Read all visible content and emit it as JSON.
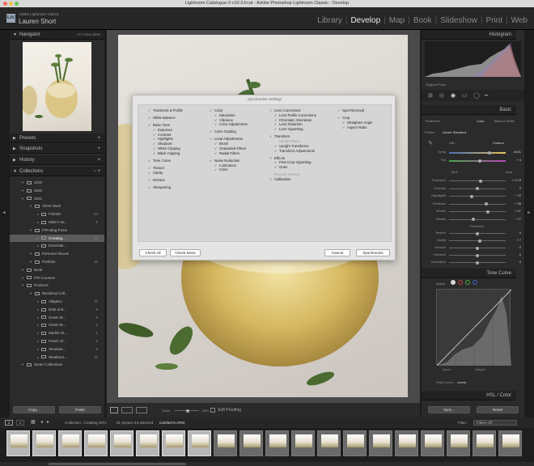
{
  "window_title": "Lightroom Catalogue-2-v10-3.lrcat - Adobe Photoshop Lightroom Classic - Develop",
  "identity": {
    "logo": "Lrc",
    "app": "Adobe Lightroom Classic",
    "user": "Lauren Short"
  },
  "modules": [
    "Library",
    "Develop",
    "Map",
    "Book",
    "Slideshow",
    "Print",
    "Web"
  ],
  "active_module": "Develop",
  "left_panel": {
    "navigator": {
      "title": "Navigator",
      "zoom": [
        "FIT",
        "100%",
        "200%"
      ]
    },
    "panels": [
      {
        "title": "Presets",
        "action": "+"
      },
      {
        "title": "Snapshots",
        "action": "+"
      },
      {
        "title": "History",
        "action": "×"
      }
    ],
    "collections_title": "Collections",
    "collections_actions": "− +",
    "collections": [
      {
        "label": "2019",
        "indent": 1,
        "count": ""
      },
      {
        "label": "2020",
        "indent": 1,
        "count": ""
      },
      {
        "label": "2021",
        "indent": 1,
        "count": ""
      },
      {
        "label": "Client Work",
        "indent": 2,
        "count": ""
      },
      {
        "label": "FOOD!!",
        "indent": 3,
        "count": "24"
      },
      {
        "label": "Mike's He...",
        "indent": 3,
        "count": "8"
      },
      {
        "label": "FPA Blog Posts",
        "indent": 2,
        "count": ""
      },
      {
        "label": "Creating...",
        "indent": 3,
        "count": "61",
        "selected": true
      },
      {
        "label": "Essential...",
        "indent": 3,
        "count": ""
      },
      {
        "label": "Personal Shoots",
        "indent": 2,
        "count": ""
      },
      {
        "label": "Portfolio",
        "indent": 2,
        "count": "15"
      },
      {
        "label": "Book",
        "indent": 1,
        "count": ""
      },
      {
        "label": "FPA Courses",
        "indent": 1,
        "count": ""
      },
      {
        "label": "Products",
        "indent": 1,
        "count": ""
      },
      {
        "label": "Backdrop Coll...",
        "indent": 2,
        "count": ""
      },
      {
        "label": "Alligator...",
        "indent": 3,
        "count": "11"
      },
      {
        "label": "Dark and...",
        "indent": 3,
        "count": "6"
      },
      {
        "label": "Green M...",
        "indent": 3,
        "count": "6"
      },
      {
        "label": "Green M...",
        "indent": 3,
        "count": "6"
      },
      {
        "label": "Marble St...",
        "indent": 3,
        "count": "1"
      },
      {
        "label": "Peach St...",
        "indent": 3,
        "count": "6"
      },
      {
        "label": "Venetian...",
        "indent": 3,
        "count": "5"
      },
      {
        "label": "Weathere...",
        "indent": 3,
        "count": "11"
      },
      {
        "label": "Smart Collections",
        "indent": 1,
        "count": ""
      }
    ],
    "copy": "Copy...",
    "paste": "Paste"
  },
  "dialog": {
    "title": "Synchronize Settings",
    "columns": [
      [
        {
          "label": "Treatment & Profile",
          "checked": true,
          "indent": 0,
          "gap": 0
        },
        {
          "label": "White Balance",
          "checked": true,
          "indent": 0,
          "gap": 1
        },
        {
          "label": "Basic Tone",
          "checked": true,
          "indent": 0,
          "gap": 1
        },
        {
          "label": "Exposure",
          "checked": true,
          "indent": 1
        },
        {
          "label": "Contrast",
          "checked": true,
          "indent": 1
        },
        {
          "label": "Highlights",
          "checked": true,
          "indent": 1
        },
        {
          "label": "Shadows",
          "checked": true,
          "indent": 1
        },
        {
          "label": "White Clipping",
          "checked": true,
          "indent": 1
        },
        {
          "label": "Black Clipping",
          "checked": true,
          "indent": 1
        },
        {
          "label": "Tone Curve",
          "checked": true,
          "indent": 0,
          "gap": 1
        },
        {
          "label": "Texture",
          "checked": true,
          "indent": 0,
          "gap": 1
        },
        {
          "label": "Clarity",
          "checked": true,
          "indent": 0
        },
        {
          "label": "Dehaze",
          "checked": true,
          "indent": 0,
          "gap": 1
        },
        {
          "label": "Sharpening",
          "checked": true,
          "indent": 0,
          "gap": 1
        }
      ],
      [
        {
          "label": "Color",
          "checked": true,
          "indent": 0,
          "gap": 0
        },
        {
          "label": "Saturation",
          "checked": true,
          "indent": 1
        },
        {
          "label": "Vibrance",
          "checked": true,
          "indent": 1
        },
        {
          "label": "Color Adjustments",
          "checked": true,
          "indent": 1
        },
        {
          "label": "Color Grading",
          "checked": true,
          "indent": 0,
          "gap": 1
        },
        {
          "label": "Local Adjustments",
          "checked": true,
          "indent": 0,
          "gap": 1
        },
        {
          "label": "Brush",
          "checked": true,
          "indent": 1
        },
        {
          "label": "Graduated Filters",
          "checked": true,
          "indent": 1
        },
        {
          "label": "Radial Filters",
          "checked": true,
          "indent": 1
        },
        {
          "label": "Noise Reduction",
          "checked": true,
          "indent": 0,
          "gap": 1
        },
        {
          "label": "Luminance",
          "checked": true,
          "indent": 1
        },
        {
          "label": "Color",
          "checked": true,
          "indent": 1
        }
      ],
      [
        {
          "label": "Lens Corrections",
          "checked": true,
          "indent": 0,
          "gap": 0
        },
        {
          "label": "Lens Profile Corrections",
          "checked": true,
          "indent": 1
        },
        {
          "label": "Chromatic Aberration",
          "checked": true,
          "indent": 1
        },
        {
          "label": "Lens Distortion",
          "checked": true,
          "indent": 1
        },
        {
          "label": "Lens Vignetting",
          "checked": true,
          "indent": 1
        },
        {
          "label": "Transform",
          "checked": true,
          "indent": 0,
          "gap": 1
        },
        {
          "label": "Upright Mode",
          "checked": false,
          "indent": 1,
          "disabled": true
        },
        {
          "label": "Upright Transforms",
          "checked": true,
          "indent": 1
        },
        {
          "label": "Transform Adjustments",
          "checked": true,
          "indent": 1
        },
        {
          "label": "Effects",
          "checked": true,
          "indent": 0,
          "gap": 1
        },
        {
          "label": "Post-Crop Vignetting",
          "checked": true,
          "indent": 1
        },
        {
          "label": "Grain",
          "checked": true,
          "indent": 1
        },
        {
          "label": "Process Version",
          "checked": false,
          "indent": 0,
          "gap": 1,
          "disabled": true
        },
        {
          "label": "Calibration",
          "checked": true,
          "indent": 0
        }
      ],
      [
        {
          "label": "Spot Removal",
          "checked": true,
          "indent": 0,
          "gap": 0
        },
        {
          "label": "Crop",
          "checked": true,
          "indent": 0,
          "gap": 1
        },
        {
          "label": "Straighten Angle",
          "checked": true,
          "indent": 1
        },
        {
          "label": "Aspect Ratio",
          "checked": true,
          "indent": 1
        }
      ]
    ],
    "check_all": "Check All",
    "check_none": "Check None",
    "cancel": "Cancel",
    "synchronize": "Synchronize"
  },
  "toolbar": {
    "zoom_label": "Zoom",
    "zoom_value": "42%",
    "soft_proofing": "Soft Proofing"
  },
  "right_panel": {
    "histogram_title": "Histogram",
    "original_photo": "Original Photo",
    "basic_title": "Basic",
    "treatment": "Treatment :",
    "color": "Color",
    "bw": "Black & White",
    "profile_label": "Profile :",
    "profile": "Adobe Standard",
    "wb_label": "WB :",
    "wb_value": "Custom",
    "temp": {
      "label": "Temp",
      "value": "6431"
    },
    "tint": {
      "label": "Tint",
      "value": "+ 3"
    },
    "tone_label": "Tone",
    "auto": "Auto",
    "tone_sliders": [
      {
        "label": "Exposure",
        "value": "+ 0.15"
      },
      {
        "label": "Contrast",
        "value": "0"
      },
      {
        "label": "Highlights",
        "value": "− 22"
      },
      {
        "label": "Shadows",
        "value": "+ 38"
      },
      {
        "label": "Whites",
        "value": "+ 47"
      },
      {
        "label": "Blacks",
        "value": "− 17"
      }
    ],
    "presence_label": "Presence",
    "presence_sliders": [
      {
        "label": "Texture",
        "value": "0"
      },
      {
        "label": "Clarity",
        "value": "+ 7"
      },
      {
        "label": "Dehaze",
        "value": "0"
      },
      {
        "label": "Vibrance",
        "value": "0"
      },
      {
        "label": "Saturation",
        "value": "0"
      }
    ],
    "tone_curve_title": "Tone Curve",
    "adjust_label": "Adjust",
    "input_label": "Input :",
    "output_label": "Output :",
    "point_curve": "Point Curve :",
    "point_curve_value": "Linear",
    "hsl_title": "HSL / Color",
    "sync": "Sync...",
    "reset": "Reset"
  },
  "status_bar": {
    "pages": [
      "1",
      "2"
    ],
    "collection_text": "Collection : Creating GIFs",
    "count_text": "61 photos /13 selected",
    "file": "/untitled-9.ARW",
    "filter_label": "Filter :",
    "filter_value": "Filters Off"
  },
  "filmstrip": {
    "thumb_count": 20,
    "selected_count": 8
  }
}
